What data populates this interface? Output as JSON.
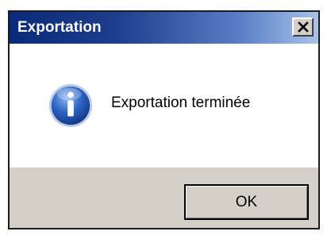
{
  "window": {
    "title": "Exportation",
    "close_icon": "close-icon"
  },
  "message": {
    "icon": "info-icon",
    "text": "Exportation terminée"
  },
  "buttons": {
    "ok_label": "OK"
  }
}
